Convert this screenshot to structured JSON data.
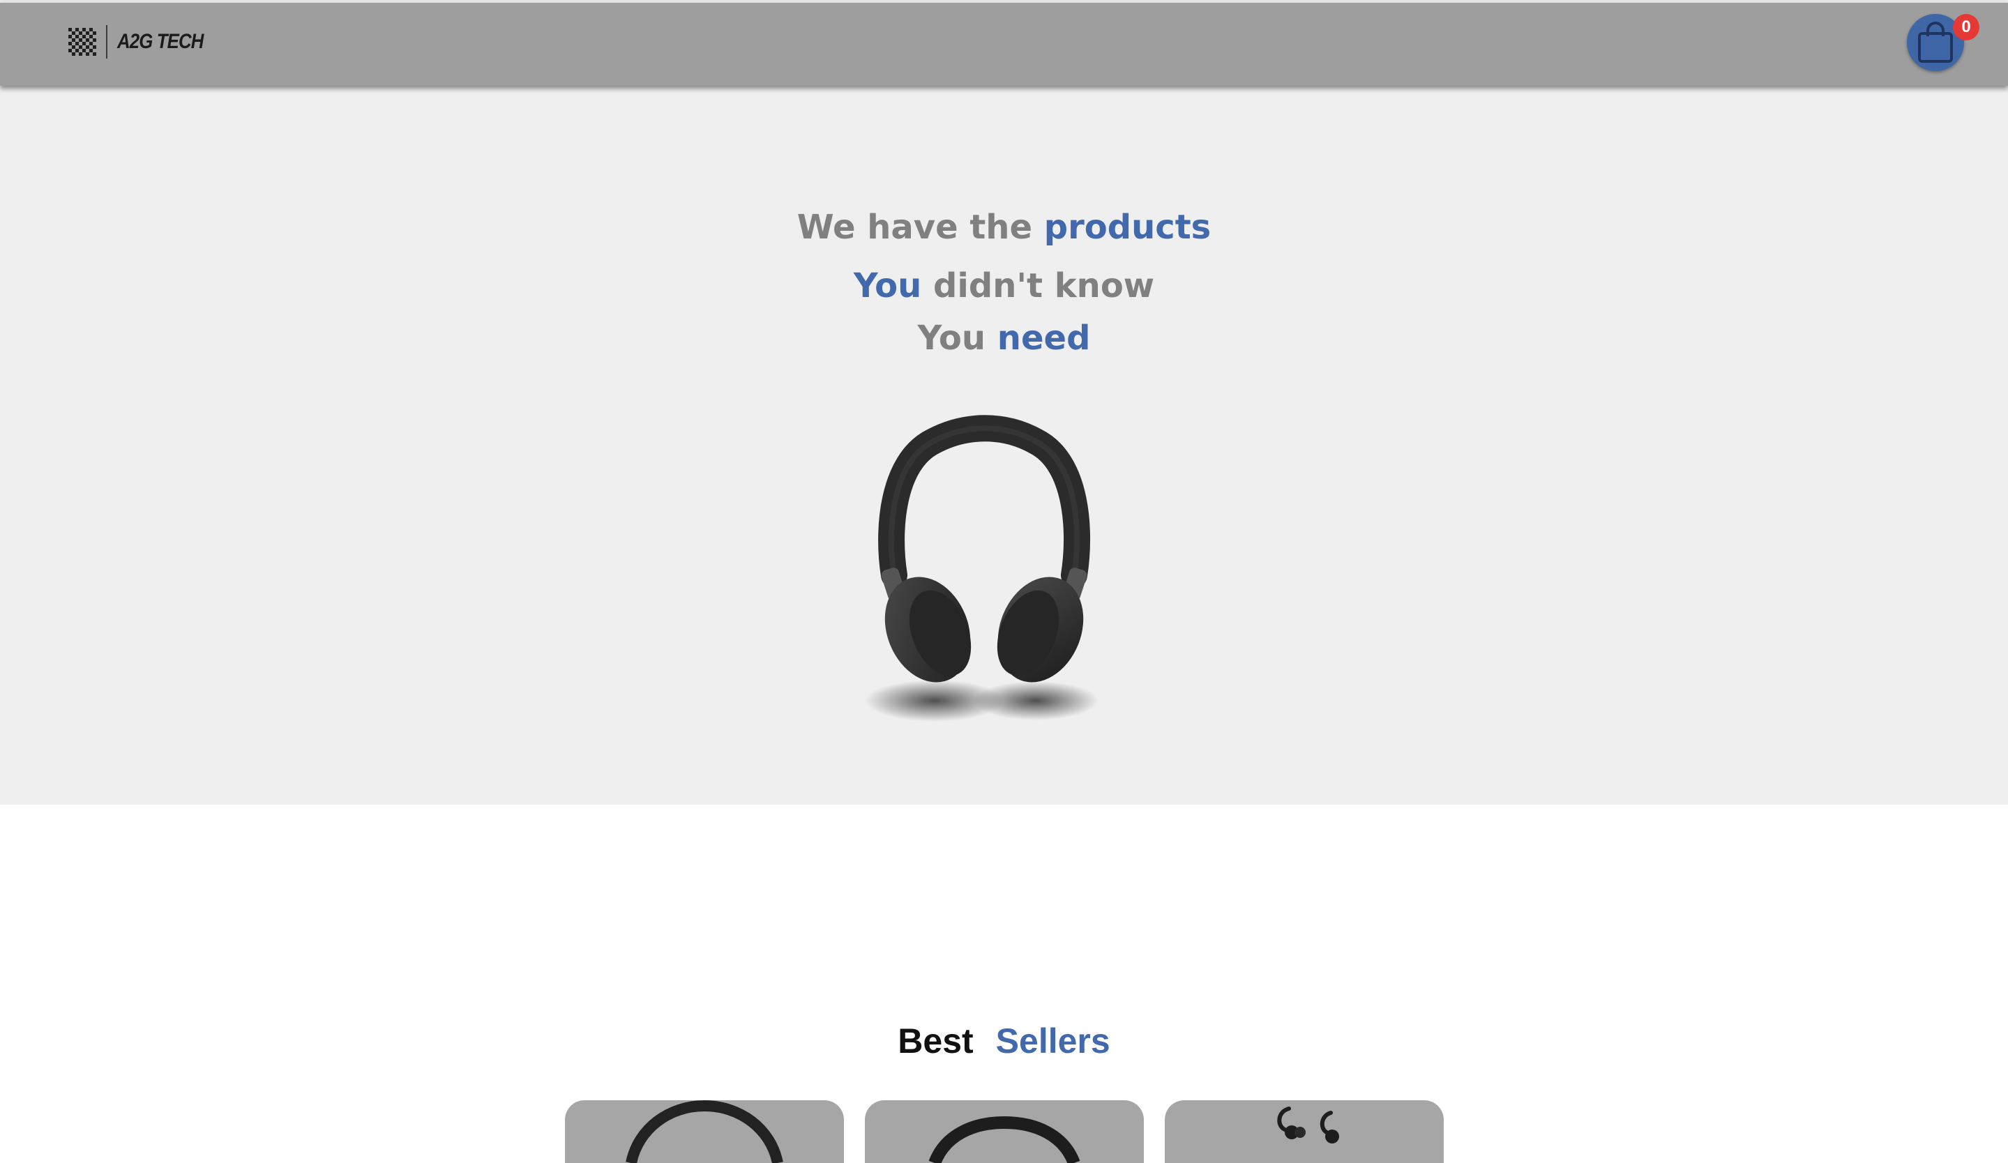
{
  "navbar": {
    "brand_name": "A2G TECH",
    "cart_count": "0",
    "brand_logo_icon": "checkered-grid-logo",
    "cart_icon": "shopping-bag-icon"
  },
  "hero": {
    "line1": {
      "plain": "We have the ",
      "accent": "products"
    },
    "line2": {
      "accent": "You",
      "plain": " didn't know"
    },
    "line3": {
      "plain": "You ",
      "accent": "need"
    },
    "image": "headphones-image"
  },
  "best_sellers": {
    "title_word1": "Best",
    "title_word2": "Sellers",
    "products": [
      {
        "image": "over-ear-headphones-image"
      },
      {
        "image": "headphones-image"
      },
      {
        "image": "wireless-earbuds-image"
      }
    ]
  },
  "colors": {
    "navbar": "#9e9e9e",
    "accent": "#4269ab",
    "hero_text": "#808080",
    "hero_bg": "#efefef",
    "badge": "#e53935"
  }
}
